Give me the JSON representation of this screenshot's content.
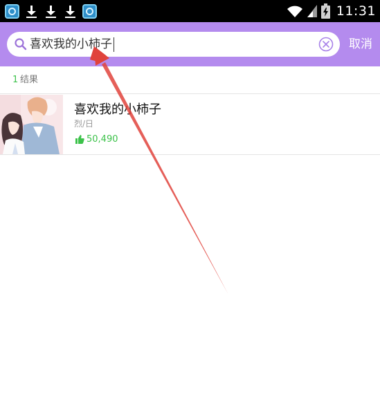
{
  "status_bar": {
    "time": "11:31",
    "left_icons": [
      "app-icon",
      "download-icon",
      "download-icon",
      "download-icon",
      "app-icon"
    ],
    "right_icons": [
      "wifi-icon",
      "cellular-signal-icon",
      "battery-icon"
    ]
  },
  "search": {
    "query": "喜欢我的小柿子",
    "cancel_label": "取消",
    "icon": "search-icon",
    "clear_icon": "clear-icon"
  },
  "results": {
    "count": "1",
    "count_label": "结果",
    "items": [
      {
        "title": "喜欢我的小柿子",
        "author": "烈/日",
        "likes": "50,490",
        "like_icon": "thumbs-up-icon"
      }
    ]
  },
  "colors": {
    "header_bg": "#b48bee",
    "accent_green": "#3cc24a",
    "annotation_red": "#e0433c"
  }
}
